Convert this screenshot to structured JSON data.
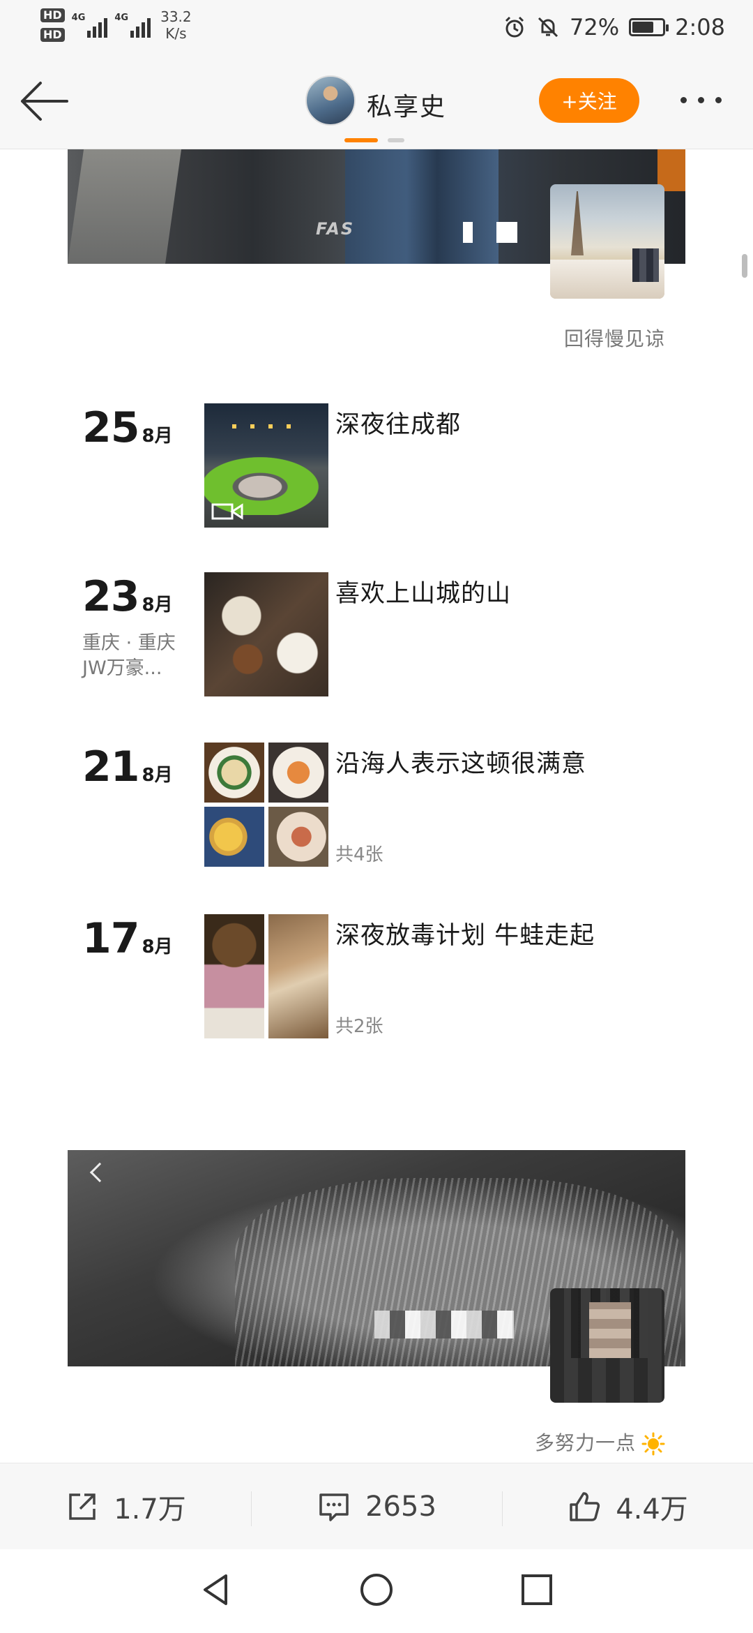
{
  "status_bar": {
    "hd1": "HD",
    "hd2": "HD",
    "net_label": "4G",
    "net_speed_value": "33.2",
    "net_speed_unit": "K/s",
    "battery_percent": "72%",
    "battery_level": 0.72,
    "time": "2:08"
  },
  "header": {
    "username": "私享史",
    "follow_label": "+关注",
    "accent_color": "#ff8200"
  },
  "feed": {
    "top_caption": "回得慢见谅",
    "entries": [
      {
        "day": "25",
        "month": "8月",
        "location": "",
        "title": "深夜往成都",
        "count": "",
        "media": "video"
      },
      {
        "day": "23",
        "month": "8月",
        "location": "重庆 · 重庆JW万豪...",
        "title": "喜欢上山城的山",
        "count": "",
        "media": "single"
      },
      {
        "day": "21",
        "month": "8月",
        "location": "",
        "title": "沿海人表示这顿很满意",
        "count": "共4张",
        "media": "grid4"
      },
      {
        "day": "17",
        "month": "8月",
        "location": "",
        "title": "深夜放毒计划 牛蛙走起",
        "count": "共2张",
        "media": "grid2"
      }
    ],
    "bottom_caption": "多努力一点"
  },
  "actions": {
    "share_count": "1.7万",
    "comment_count": "2653",
    "like_count": "4.4万"
  },
  "icons": {
    "back": "back-arrow-icon",
    "more": "more-dots-icon",
    "share": "share-icon",
    "comment": "comment-icon",
    "like": "thumbs-up-icon",
    "video": "video-camera-icon",
    "sun": "sun-emoji-icon"
  }
}
